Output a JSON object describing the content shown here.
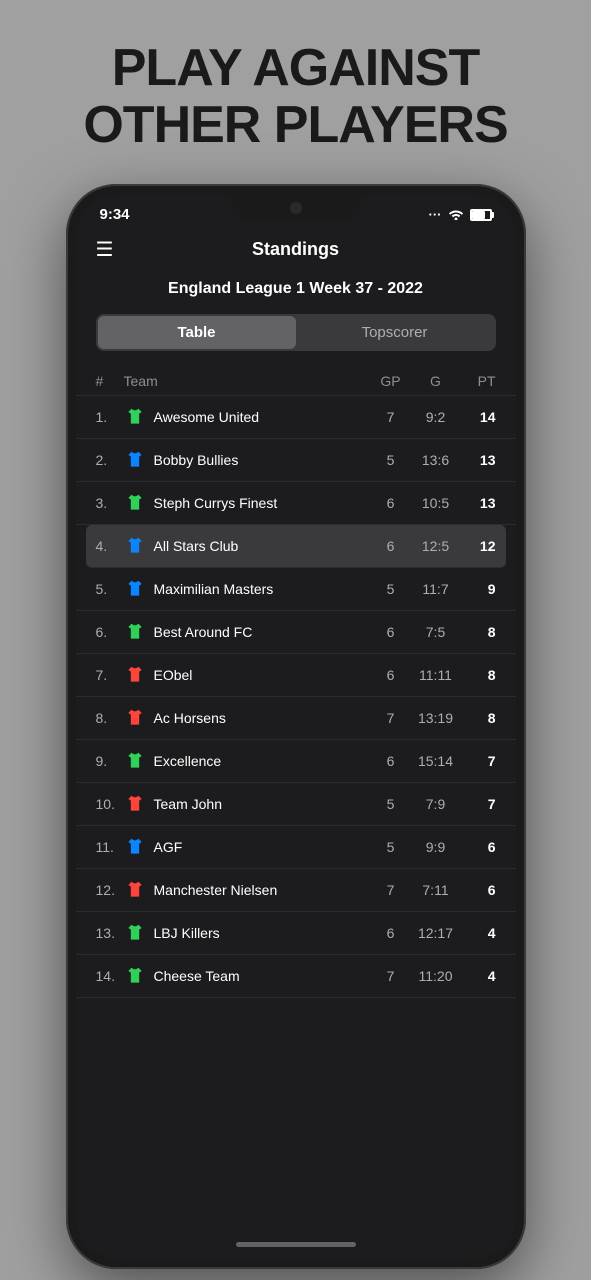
{
  "headline": {
    "line1": "PLAY AGAINST",
    "line2": "OTHER PLAYERS"
  },
  "status_bar": {
    "time": "9:34",
    "dots": "···"
  },
  "app": {
    "title": "Standings",
    "league": "England League 1 Week 37 - 2022",
    "tabs": [
      {
        "label": "Table",
        "active": true
      },
      {
        "label": "Topscorer",
        "active": false
      }
    ],
    "columns": {
      "rank": "#",
      "team": "Team",
      "gp": "GP",
      "g": "G",
      "pt": "PT"
    },
    "rows": [
      {
        "rank": "1.",
        "shirt_color": "green",
        "shirt": "👕",
        "name": "Awesome United",
        "gp": "7",
        "g": "9:2",
        "pt": "14",
        "highlighted": false
      },
      {
        "rank": "2.",
        "shirt_color": "blue",
        "shirt": "👕",
        "name": "Bobby Bullies",
        "gp": "5",
        "g": "13:6",
        "pt": "13",
        "highlighted": false
      },
      {
        "rank": "3.",
        "shirt_color": "green",
        "shirt": "👕",
        "name": "Steph Currys Finest",
        "gp": "6",
        "g": "10:5",
        "pt": "13",
        "highlighted": false
      },
      {
        "rank": "4.",
        "shirt_color": "blue",
        "shirt": "👕",
        "name": "All Stars Club",
        "gp": "6",
        "g": "12:5",
        "pt": "12",
        "highlighted": true
      },
      {
        "rank": "5.",
        "shirt_color": "blue",
        "shirt": "👕",
        "name": "Maximilian Masters",
        "gp": "5",
        "g": "11:7",
        "pt": "9",
        "highlighted": false
      },
      {
        "rank": "6.",
        "shirt_color": "green",
        "shirt": "👕",
        "name": "Best Around FC",
        "gp": "6",
        "g": "7:5",
        "pt": "8",
        "highlighted": false
      },
      {
        "rank": "7.",
        "shirt_color": "red",
        "shirt": "👕",
        "name": "EObel",
        "gp": "6",
        "g": "11:11",
        "pt": "8",
        "highlighted": false
      },
      {
        "rank": "8.",
        "shirt_color": "red",
        "shirt": "👕",
        "name": "Ac Horsens",
        "gp": "7",
        "g": "13:19",
        "pt": "8",
        "highlighted": false
      },
      {
        "rank": "9.",
        "shirt_color": "green",
        "shirt": "👕",
        "name": "Excellence",
        "gp": "6",
        "g": "15:14",
        "pt": "7",
        "highlighted": false
      },
      {
        "rank": "10.",
        "shirt_color": "red",
        "shirt": "👕",
        "name": "Team John",
        "gp": "5",
        "g": "7:9",
        "pt": "7",
        "highlighted": false
      },
      {
        "rank": "11.",
        "shirt_color": "blue",
        "shirt": "👕",
        "name": "AGF",
        "gp": "5",
        "g": "9:9",
        "pt": "6",
        "highlighted": false
      },
      {
        "rank": "12.",
        "shirt_color": "red",
        "shirt": "👕",
        "name": "Manchester Nielsen",
        "gp": "7",
        "g": "7:11",
        "pt": "6",
        "highlighted": false
      },
      {
        "rank": "13.",
        "shirt_color": "green",
        "shirt": "👕",
        "name": "LBJ Killers",
        "gp": "6",
        "g": "12:17",
        "pt": "4",
        "highlighted": false
      },
      {
        "rank": "14.",
        "shirt_color": "green",
        "shirt": "👕",
        "name": "Cheese Team",
        "gp": "7",
        "g": "11:20",
        "pt": "4",
        "highlighted": false
      }
    ]
  }
}
